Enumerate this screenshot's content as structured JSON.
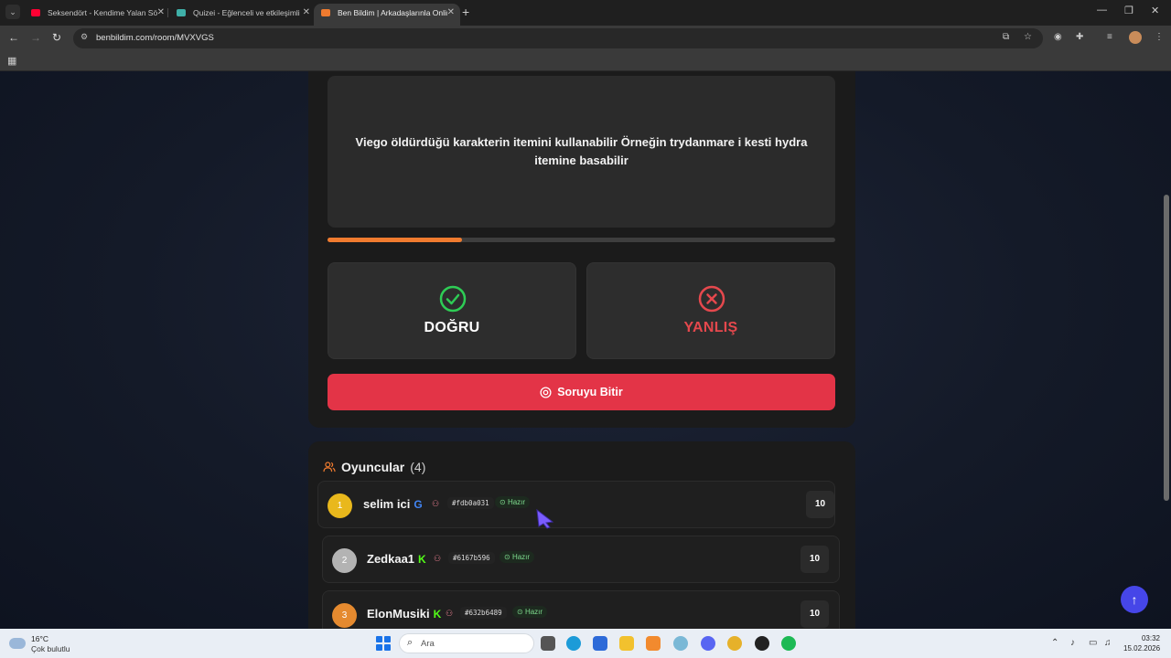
{
  "browser": {
    "tabs": [
      {
        "title": "Seksendört - Kendime Yalan Söyledim",
        "favicon_color": "#ff0033"
      },
      {
        "title": "Quizei - Eğlenceli ve etkileşimli",
        "favicon_color": "#3fb0a8"
      },
      {
        "title": "Ben Bildim | Arkadaşlarınla Online",
        "favicon_color": "#f07b2f"
      }
    ],
    "active_tab": 2,
    "url": "benbildim.com/room/MVXVGS"
  },
  "question": {
    "text": "Viego öldürdüğü karakterin itemini kullanabilir Örneğin trydanmare i kesti hydra itemine basabilir",
    "timer_progress": 0.265
  },
  "answers": {
    "true_label": "DOĞRU",
    "false_label": "YANLIŞ",
    "true_color": "#2ecc55",
    "false_color": "#e5484d"
  },
  "finish_button": "Soruyu Bitir",
  "players": {
    "title": "Oyuncular",
    "count": "(4)",
    "ready_label": "Hazır",
    "list": [
      {
        "rank": "1",
        "name": "selim ici",
        "badge": "G",
        "badge_color": "#4285f4",
        "id": "#fdb0a031",
        "score": "10",
        "rank_color": "#e9b81c"
      },
      {
        "rank": "2",
        "name": "Zedkaa1",
        "badge": "K",
        "badge_color": "#53fc18",
        "id": "#6167b596",
        "score": "10",
        "rank_color": "#b3b3b3"
      },
      {
        "rank": "3",
        "name": "ElonMusiki",
        "badge": "K",
        "badge_color": "#53fc18",
        "id": "#632b6489",
        "score": "10",
        "rank_color": "#e58a2f"
      }
    ]
  },
  "taskbar": {
    "temperature": "16°C",
    "weather": "Çok bulutlu",
    "search_placeholder": "Ara",
    "time": "03:32",
    "date": "15.02.2026"
  }
}
